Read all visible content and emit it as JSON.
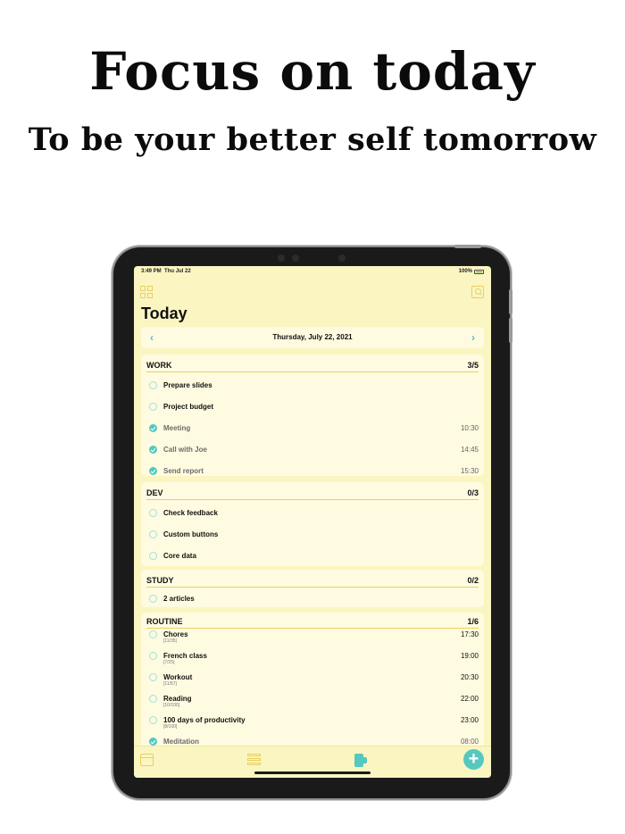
{
  "headline": {
    "title": "Focus on today",
    "subtitle": "To be your better self tomorrow"
  },
  "status_bar": {
    "time": "3:49 PM",
    "date": "Thu Jul 22",
    "battery": "100%"
  },
  "app": {
    "title": "Today",
    "date": "Thursday, July 22, 2021",
    "accent_color": "#55c8c0",
    "background_color": "#fbf5c1"
  },
  "sections": [
    {
      "name": "WORK",
      "count": "3/5",
      "tasks": [
        {
          "label": "Prepare slides",
          "time": "",
          "done": false
        },
        {
          "label": "Project budget",
          "time": "",
          "done": false
        },
        {
          "label": "Meeting",
          "time": "10:30",
          "done": true
        },
        {
          "label": "Call with Joe",
          "time": "14:45",
          "done": true
        },
        {
          "label": "Send report",
          "time": "15:30",
          "done": true
        }
      ]
    },
    {
      "name": "DEV",
      "count": "0/3",
      "tasks": [
        {
          "label": "Check feedback",
          "time": "",
          "done": false
        },
        {
          "label": "Custom buttons",
          "time": "",
          "done": false
        },
        {
          "label": "Core data",
          "time": "",
          "done": false
        }
      ]
    },
    {
      "name": "STUDY",
      "count": "0/2",
      "tasks": [
        {
          "label": "2 articles",
          "time": "",
          "done": false
        }
      ]
    },
    {
      "name": "ROUTINE",
      "count": "1/6",
      "tasks": [
        {
          "label": "Chores",
          "sub": "[11/35]",
          "time": "17:30",
          "done": false
        },
        {
          "label": "French class",
          "sub": "[7/25]",
          "time": "19:00",
          "done": false
        },
        {
          "label": "Workout",
          "sub": "[11/57]",
          "time": "20:30",
          "done": false
        },
        {
          "label": "Reading",
          "sub": "[10/100]",
          "time": "22:00",
          "done": false
        },
        {
          "label": "100 days of productivity",
          "sub": "[8/100]",
          "time": "23:00",
          "done": false
        },
        {
          "label": "Meditation",
          "sub": "",
          "time": "08:00",
          "done": true
        }
      ]
    }
  ],
  "icons": {
    "grid": "grid-icon",
    "search": "search-icon",
    "calendar_tab": "calendar-icon",
    "list_tab": "list-icon",
    "focus_tab": "focus-icon",
    "add": "+"
  }
}
